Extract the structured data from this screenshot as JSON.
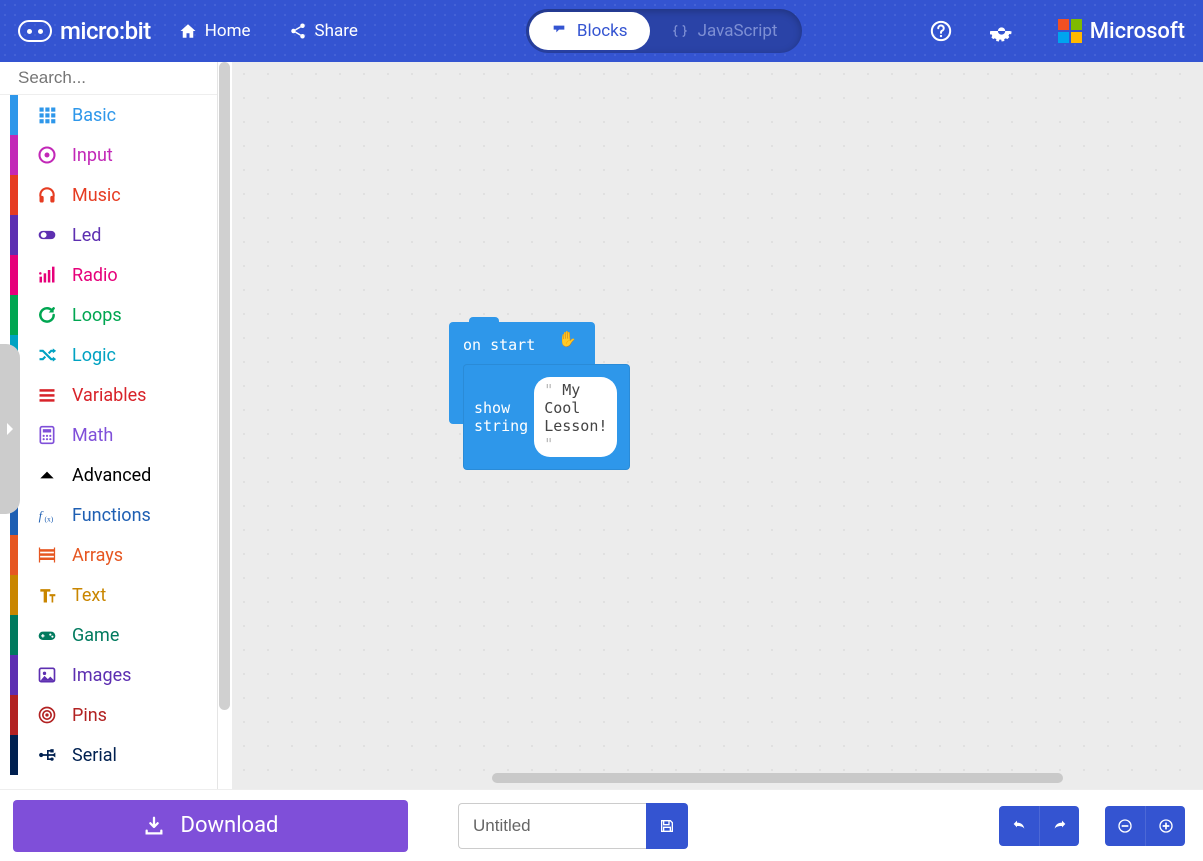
{
  "header": {
    "logo_text": "micro:bit",
    "home": "Home",
    "share": "Share",
    "blocks": "Blocks",
    "javascript": "JavaScript",
    "microsoft": "Microsoft"
  },
  "search": {
    "placeholder": "Search..."
  },
  "categories": [
    {
      "label": "Basic",
      "color": "#2e97ea",
      "icon": "grid"
    },
    {
      "label": "Input",
      "color": "#c228b7",
      "icon": "target"
    },
    {
      "label": "Music",
      "color": "#e63c22",
      "icon": "headphones"
    },
    {
      "label": "Led",
      "color": "#5d2fb1",
      "icon": "toggle"
    },
    {
      "label": "Radio",
      "color": "#e6007a",
      "icon": "bars"
    },
    {
      "label": "Loops",
      "color": "#00a651",
      "icon": "refresh"
    },
    {
      "label": "Logic",
      "color": "#00a2c2",
      "icon": "shuffle"
    },
    {
      "label": "Variables",
      "color": "#d8232a",
      "icon": "list"
    },
    {
      "label": "Math",
      "color": "#7f4fd9",
      "icon": "calc"
    }
  ],
  "advanced_label": "Advanced",
  "advanced": [
    {
      "label": "Functions",
      "color": "#1e5fb3",
      "icon": "fx"
    },
    {
      "label": "Arrays",
      "color": "#e65722",
      "icon": "array"
    },
    {
      "label": "Text",
      "color": "#c98600",
      "icon": "text"
    },
    {
      "label": "Game",
      "color": "#007a5e",
      "icon": "gamepad"
    },
    {
      "label": "Images",
      "color": "#5d2fb1",
      "icon": "image"
    },
    {
      "label": "Pins",
      "color": "#b22222",
      "icon": "pin"
    },
    {
      "label": "Serial",
      "color": "#002050",
      "icon": "usb"
    }
  ],
  "blocks": {
    "on_start": "on start",
    "show_string": "show string",
    "string_value": "My Cool Lesson!"
  },
  "footer": {
    "download": "Download",
    "project_name": "Untitled"
  }
}
